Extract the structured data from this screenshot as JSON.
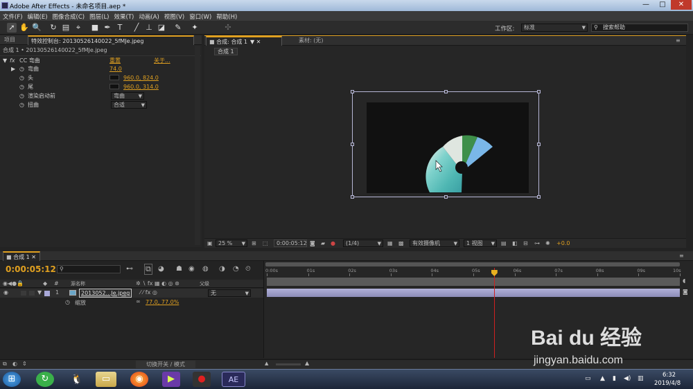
{
  "title_bar": {
    "text": "Adobe After Effects - 未命名项目.aep *",
    "min": "—",
    "max": "□",
    "close": "✕"
  },
  "menu": [
    "文件(F)",
    "编辑(E)",
    "图像合成(C)",
    "图层(L)",
    "效果(T)",
    "动画(A)",
    "视图(V)",
    "窗口(W)",
    "帮助(H)"
  ],
  "toolbar": {
    "workspace_label": "工作区:",
    "workspace_value": "标准",
    "search_placeholder": "搜索帮助"
  },
  "effect_panel": {
    "tab_project": "项目",
    "tab_effect": "特效控制台: 20130526140022_5fMJe.jpeg",
    "path": "合成 1 • 20130526140022_5fMJe.jpeg",
    "fx_name": "CC 弯曲",
    "reset": "重置",
    "about": "关于...",
    "rows": [
      {
        "label": "弯曲",
        "value": "74.0"
      },
      {
        "label": "头",
        "value": "960.0, 824.0"
      },
      {
        "label": "尾",
        "value": "960.0, 314.0"
      },
      {
        "label": "渲染启动前",
        "value": "弯曲"
      },
      {
        "label": "扭曲",
        "value": "合适"
      }
    ]
  },
  "comp_panel": {
    "tab_comp": "合成: 合成 1",
    "tab_footage": "素材: (无)",
    "subtab": "合成 1",
    "zoom": "25 %",
    "timecode": "0:00:05:12",
    "resolution": "(1/4)",
    "camera": "有效摄像机",
    "views": "1 视图",
    "exposure": "+0.0"
  },
  "timeline": {
    "tab": "合成 1",
    "timecode": "0:00:05:12",
    "col_source": "源名称",
    "col_parent": "父级",
    "layer_num": "1",
    "layer_name": "2013052...Je.jpeg",
    "parent_value": "无",
    "sub_prop": "缩放",
    "sub_value": "77.0, 77.0%",
    "ruler": [
      "0:00s",
      "01s",
      "02s",
      "03s",
      "04s",
      "05s",
      "06s",
      "07s",
      "08s",
      "09s",
      "10s"
    ],
    "playhead_seconds": 5.5,
    "toggle_label": "切换开关 / 模式"
  },
  "taskbar": {
    "time": "6:32",
    "date": "2019/4/8",
    "ae_label": "AE"
  },
  "watermark": {
    "brand": "Bai du 经验",
    "url": "jingyan.baidu.com"
  }
}
